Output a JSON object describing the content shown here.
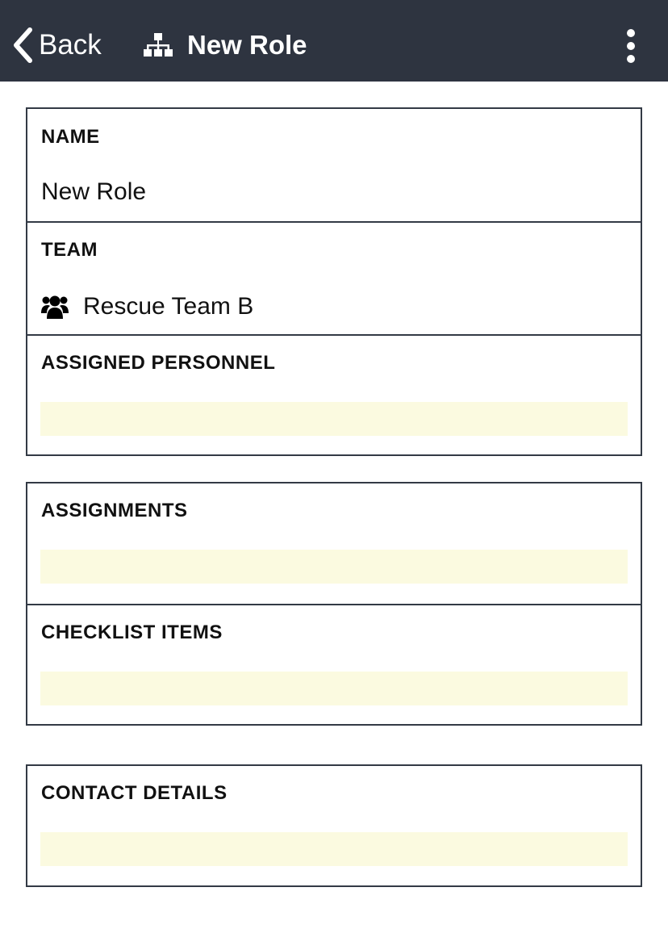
{
  "header": {
    "back_label": "Back",
    "back_icon": "chevron-left-icon",
    "title": "New Role",
    "title_icon": "org-chart-icon",
    "menu_icon": "vertical-dots-icon",
    "background_color": "#2e3440"
  },
  "section_main": {
    "name": {
      "label": "NAME",
      "value": "New Role"
    },
    "team": {
      "label": "TEAM",
      "value": "Rescue Team B",
      "icon": "users-icon"
    },
    "assigned_personnel": {
      "label": "ASSIGNED PERSONNEL",
      "value": ""
    }
  },
  "section_tasks": {
    "assignments": {
      "label": "ASSIGNMENTS",
      "value": ""
    },
    "checklist_items": {
      "label": "CHECKLIST ITEMS",
      "value": ""
    }
  },
  "section_contact": {
    "contact_details": {
      "label": "CONTACT DETAILS",
      "value": ""
    }
  },
  "colors": {
    "empty_field": "#fbfae0",
    "border": "#333a45"
  }
}
